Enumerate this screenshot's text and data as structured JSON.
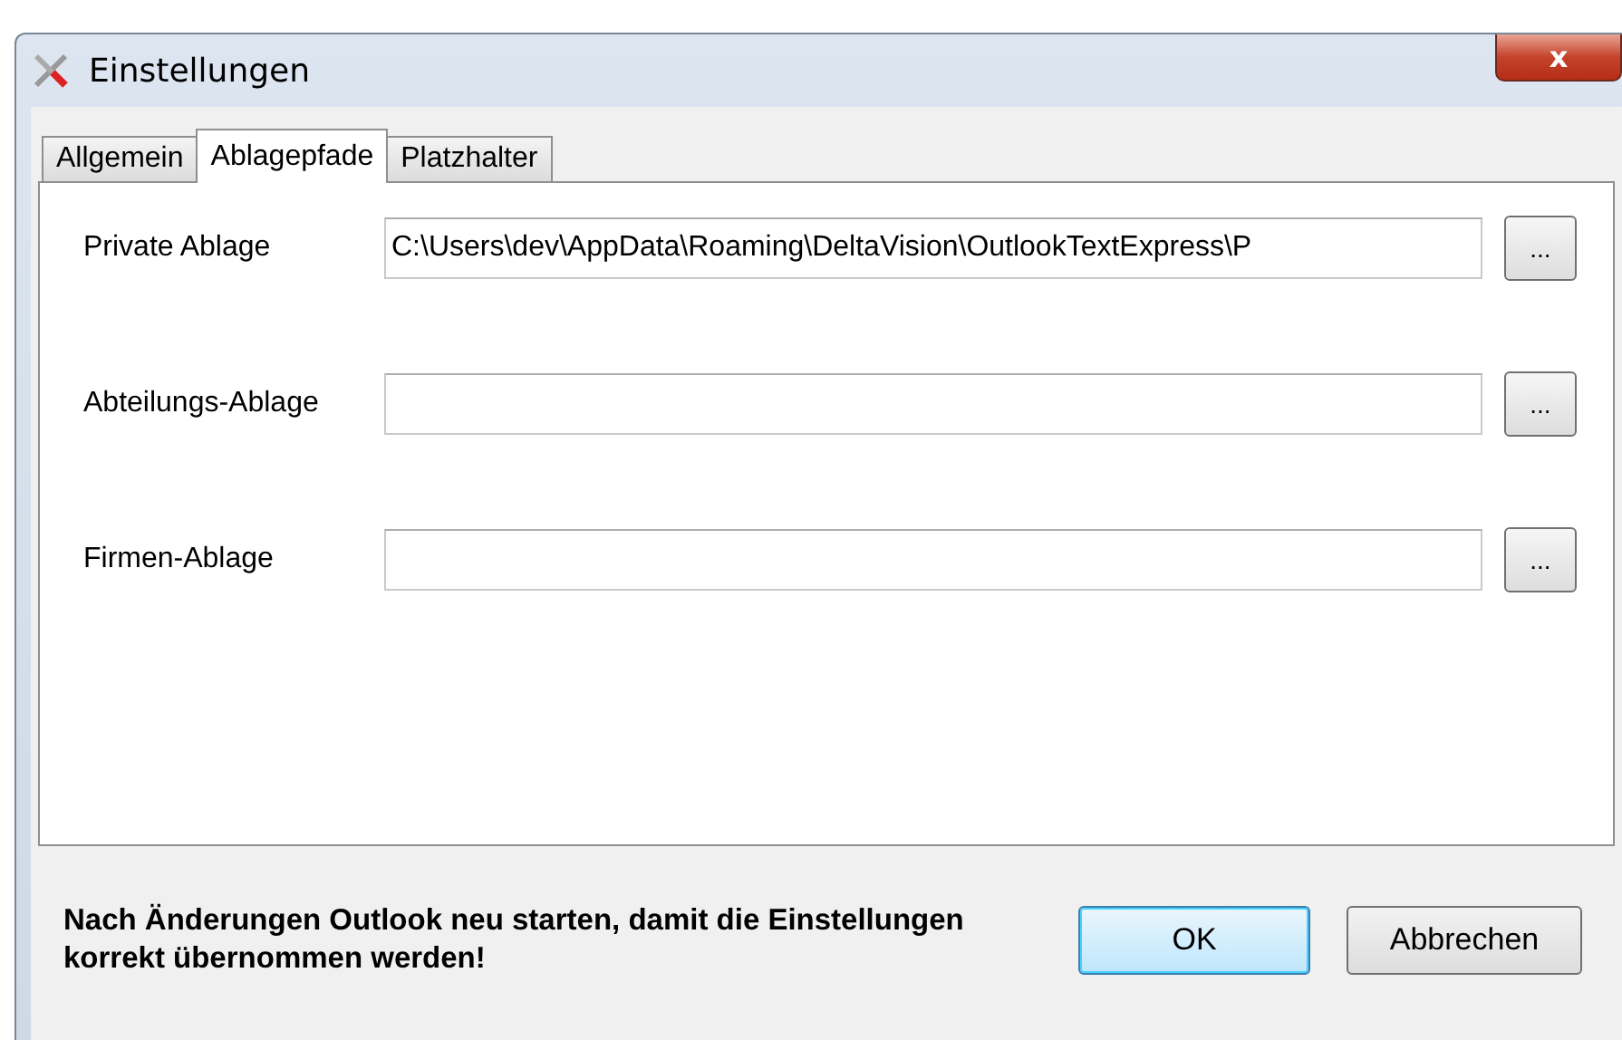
{
  "window": {
    "title": "Einstellungen",
    "close": "x"
  },
  "tabs": [
    {
      "label": "Allgemein",
      "selected": false
    },
    {
      "label": "Ablagepfade",
      "selected": true
    },
    {
      "label": "Platzhalter",
      "selected": false
    }
  ],
  "fields": [
    {
      "label": "Private Ablage",
      "value": "C:\\Users\\dev\\AppData\\Roaming\\DeltaVision\\OutlookTextExpress\\P",
      "browse": "..."
    },
    {
      "label": "Abteilungs-Ablage",
      "browse": "..."
    },
    {
      "label": "Firmen-Ablage",
      "browse": "..."
    }
  ],
  "note": "Nach Änderungen Outlook neu starten, damit die Einstellungen korrekt übernommen werden!",
  "buttons": [
    {
      "label": "OK",
      "kind": "default"
    },
    {
      "label": "Abbrechen",
      "kind": "normal"
    }
  ]
}
